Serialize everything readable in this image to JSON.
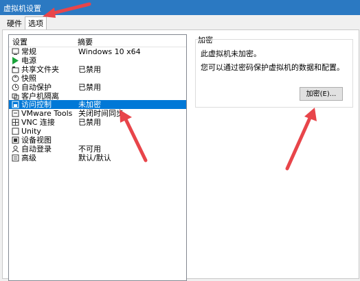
{
  "window": {
    "title": "虚拟机设置"
  },
  "tabs": [
    {
      "label": "硬件"
    },
    {
      "label": "选项"
    }
  ],
  "list": {
    "headers": {
      "setting": "设置",
      "summary": "摘要"
    },
    "rows": [
      {
        "icon": "monitor-icon",
        "name": "常规",
        "summary": "Windows 10 x64"
      },
      {
        "icon": "power-icon",
        "name": "电源",
        "summary": ""
      },
      {
        "icon": "shared-folder-icon",
        "name": "共享文件夹",
        "summary": "已禁用"
      },
      {
        "icon": "snapshot-icon",
        "name": "快照",
        "summary": ""
      },
      {
        "icon": "autoprotect-icon",
        "name": "自动保护",
        "summary": "已禁用"
      },
      {
        "icon": "guest-isolation-icon",
        "name": "客户机隔离",
        "summary": ""
      },
      {
        "icon": "access-control-icon",
        "name": "访问控制",
        "summary": "未加密"
      },
      {
        "icon": "vmware-tools-icon",
        "name": "VMware Tools",
        "summary": "关闭时间同步"
      },
      {
        "icon": "vnc-icon",
        "name": "VNC 连接",
        "summary": "已禁用"
      },
      {
        "icon": "unity-icon",
        "name": "Unity",
        "summary": ""
      },
      {
        "icon": "device-view-icon",
        "name": "设备视图",
        "summary": ""
      },
      {
        "icon": "autologin-icon",
        "name": "自动登录",
        "summary": "不可用"
      },
      {
        "icon": "advanced-icon",
        "name": "高级",
        "summary": "默认/默认"
      }
    ],
    "selected_index": 6
  },
  "encryption": {
    "title": "加密",
    "status": "此虚拟机未加密。",
    "description": "您可以通过密码保护虚拟机的数据和配置。",
    "button": "加密(E)..."
  },
  "colors": {
    "titlebar": "#2b79c2",
    "selection": "#0078d7",
    "arrow": "#e8454a"
  }
}
